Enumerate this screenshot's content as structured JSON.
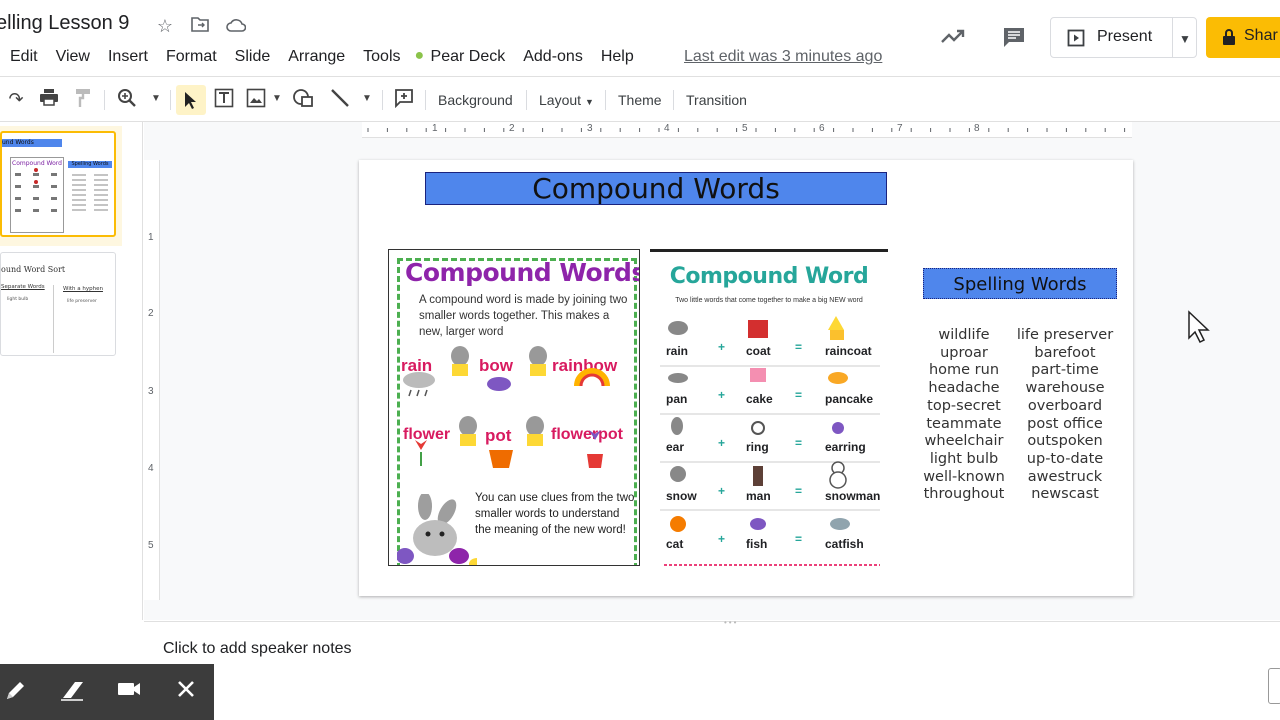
{
  "app": {
    "doc_title": "elling Lesson 9",
    "last_edit": "Last edit was 3 minutes ago"
  },
  "menu": [
    "Edit",
    "View",
    "Insert",
    "Format",
    "Slide",
    "Arrange",
    "Tools",
    "Pear Deck",
    "Add-ons",
    "Help"
  ],
  "header_buttons": {
    "present": "Present",
    "share": "Shar"
  },
  "toolbar": {
    "background": "Background",
    "layout": "Layout",
    "theme": "Theme",
    "transition": "Transition"
  },
  "ruler": {
    "h_ticks": [
      "1",
      "2",
      "3",
      "4",
      "5",
      "6",
      "7",
      "8"
    ],
    "v_ticks": [
      "1",
      "2",
      "3",
      "4",
      "5"
    ]
  },
  "filmstrip": {
    "slide1": {
      "title": "und Words",
      "sub_title": "Compound Word",
      "sub_box": "Spelling Words"
    },
    "slide2": {
      "title": "ound Word Sort",
      "col1": "Separate Words",
      "col2": "With a hyphen",
      "col1_item": "light bulb",
      "col2_item": "life preserver"
    }
  },
  "slide": {
    "title": "Compound Words",
    "poster1": {
      "heading": "Compound Words",
      "desc": "A compound word is made by joining two smaller words together. This makes a new, larger word",
      "row1": [
        "rain",
        "bow",
        "rainbow"
      ],
      "row2": [
        "flower",
        "pot",
        "flowerpot"
      ],
      "footer": "You can use clues from the two smaller words to understand the meaning of the new word!"
    },
    "poster2": {
      "heading": "Compound Word",
      "sub": "Two little words that come together to make a big NEW word",
      "rows": [
        [
          "rain",
          "coat",
          "raincoat"
        ],
        [
          "pan",
          "cake",
          "pancake"
        ],
        [
          "ear",
          "ring",
          "earring"
        ],
        [
          "snow",
          "man",
          "snowman"
        ],
        [
          "cat",
          "fish",
          "catfish"
        ]
      ]
    },
    "spelling_title": "Spelling Words",
    "words_left": [
      "wildlife",
      "uproar",
      "home run",
      "headache",
      "top-secret",
      "teammate",
      "wheelchair",
      "light bulb",
      "well-known",
      "throughout"
    ],
    "words_right": [
      "life preserver",
      "barefoot",
      "part-time",
      "warehouse",
      "overboard",
      "post office",
      "outspoken",
      "up-to-date",
      "awestruck",
      "newscast"
    ]
  },
  "notes": {
    "placeholder": "Click to add speaker notes"
  },
  "colors": {
    "accent_blue": "#4f86ec",
    "share_yellow": "#fbbc04",
    "pen_toolbar": "#3c3c3c"
  }
}
